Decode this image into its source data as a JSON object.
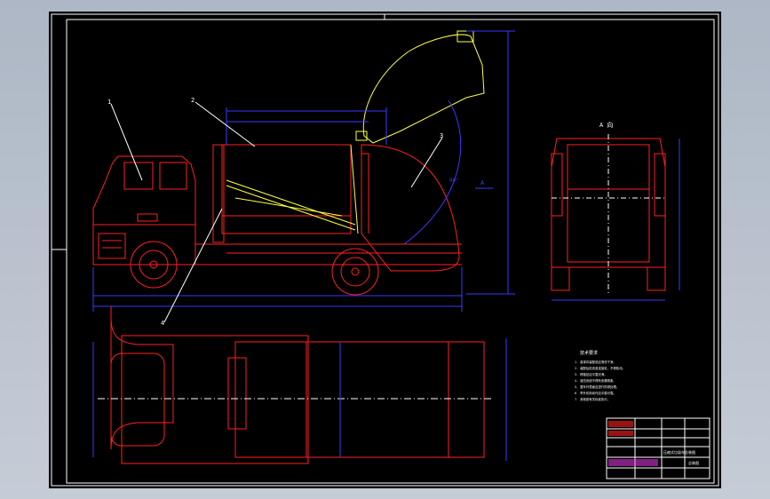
{
  "drawing": {
    "view_label_right": "A 向",
    "section_mark": "A",
    "balloons": [
      "1",
      "2",
      "3",
      "4"
    ],
    "angle_note": "90°",
    "tech_title": "技术要求",
    "tech_lines": [
      "1. 各零件装配前应清洗干净。",
      "2. 装配后检查各连接处，不得松动。",
      "3. 焊接处应平整光滑。",
      "4. 液压系统不得有渗漏现象。",
      "5. 整车外表面应进行防锈处理。",
      "6. 举升机构动作应平稳可靠。",
      "7. 其他按有关标准执行。"
    ],
    "title_block_name": "压缩式垃圾车总装图",
    "title_block_no": "总装图"
  },
  "colors": {
    "background": "#000000",
    "frame": "#ffffff",
    "truck": "#ff2020",
    "hopper": "#ffff40",
    "dimension": "#3a3aff",
    "centerline": "#ffffff",
    "text": "#ffffff"
  }
}
